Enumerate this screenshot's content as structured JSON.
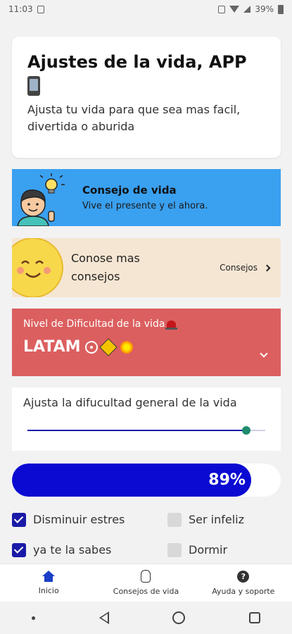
{
  "status_bar": {
    "time": "11:03",
    "battery": "39%"
  },
  "header": {
    "title": "Ajustes de la vida, APP",
    "subtitle": "Ajusta tu vida para que sea mas facil, divertida o aburida"
  },
  "tip_card": {
    "title": "Consejo de vida",
    "subtitle": "Vive el presente y el ahora.",
    "bg_color": "#3aa0f0"
  },
  "more_tips": {
    "title": "Conose mas consejos",
    "link_label": "Consejos",
    "bg_color": "#f5e6d3"
  },
  "difficulty": {
    "label": "Nivel de Dificultad de la vida",
    "selected": "LATAM",
    "bg_color": "#dc5f5f"
  },
  "slider": {
    "label": "Ajusta la difucultad general de la vida",
    "value_percent": 92
  },
  "progress": {
    "percent": 89,
    "label": "89%",
    "color": "#0a0ad2"
  },
  "checkboxes": [
    {
      "label": "Disminuir estres",
      "checked": true
    },
    {
      "label": "Ser infeliz",
      "checked": false
    },
    {
      "label": "ya te la sabes",
      "checked": true
    },
    {
      "label": "Dormir",
      "checked": false
    }
  ],
  "bottom_nav": [
    {
      "label": "Inicio",
      "icon": "home-icon"
    },
    {
      "label": "Consejos de vida",
      "icon": "hand-icon"
    },
    {
      "label": "Ayuda y soporte",
      "icon": "help-icon"
    }
  ]
}
